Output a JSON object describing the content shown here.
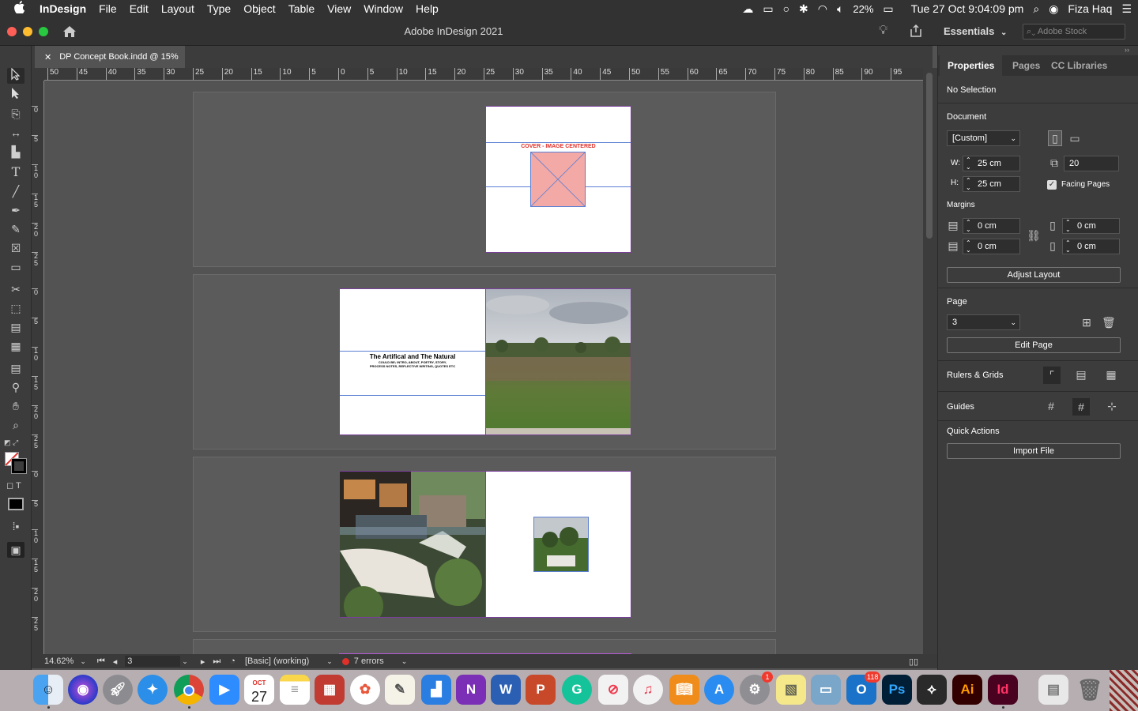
{
  "menubar": {
    "apple": "",
    "app": "InDesign",
    "items": [
      "File",
      "Edit",
      "Layout",
      "Type",
      "Object",
      "Table",
      "View",
      "Window",
      "Help"
    ],
    "battery": "22%",
    "clock": "Tue 27 Oct  9:04:09 pm",
    "user": "Fiza Haq"
  },
  "window": {
    "title": "Adobe InDesign 2021",
    "workspace": "Essentials",
    "stock_placeholder": "Adobe Stock",
    "tab_label": "DP Concept Book.indd @ 15%"
  },
  "ruler": {
    "h_labels": [
      "50",
      "45",
      "40",
      "35",
      "30",
      "25",
      "20",
      "15",
      "10",
      "5",
      "0",
      "5",
      "10",
      "15",
      "20",
      "25",
      "30",
      "35",
      "40",
      "45",
      "50",
      "55",
      "60",
      "65",
      "70",
      "75",
      "80",
      "85",
      "90",
      "95"
    ],
    "v_labels": [
      "0",
      "5",
      "10",
      "15",
      "20",
      "25",
      "0",
      "5",
      "10",
      "15",
      "20",
      "25",
      "0",
      "5",
      "10",
      "15",
      "20",
      "25"
    ]
  },
  "canvas": {
    "cover_text": "COVER - IMAGE CENTERED",
    "spread2_title": "The Artifical and The Natural",
    "spread2_sub1": "COULD BE; INTRO, ABOUT, POETRY, STORY,",
    "spread2_sub2": "PROCESS NOTES, REFLECTIVE WRITING, QUOTES ETC"
  },
  "status": {
    "zoom": "14.62%",
    "page": "3",
    "preflight_profile": "[Basic] (working)",
    "errors": "7 errors"
  },
  "panel": {
    "tabs": [
      "Properties",
      "Pages",
      "CC Libraries"
    ],
    "no_selection": "No Selection",
    "document_heading": "Document",
    "preset": "[Custom]",
    "w_label": "W:",
    "w_value": "25 cm",
    "h_label": "H:",
    "h_value": "25 cm",
    "pages_count": "20",
    "facing_pages": "Facing Pages",
    "margins_heading": "Margins",
    "margin_top": "0 cm",
    "margin_bottom": "0 cm",
    "margin_inside": "0 cm",
    "margin_outside": "0 cm",
    "adjust_layout": "Adjust Layout",
    "page_heading": "Page",
    "page_value": "3",
    "edit_page": "Edit Page",
    "rulers_grids": "Rulers & Grids",
    "guides": "Guides",
    "quick_actions": "Quick Actions",
    "import_file": "Import File"
  },
  "dock": {
    "calendar_month": "OCT",
    "calendar_day": "27",
    "badge_settings": "1",
    "badge_outlook": "118",
    "ps": "Ps",
    "ai": "Ai",
    "id": "Id"
  },
  "colors": {
    "accent_red": "#e0302a",
    "guide_blue": "#5b7fd4",
    "margin_purple": "#7b3f9b"
  }
}
